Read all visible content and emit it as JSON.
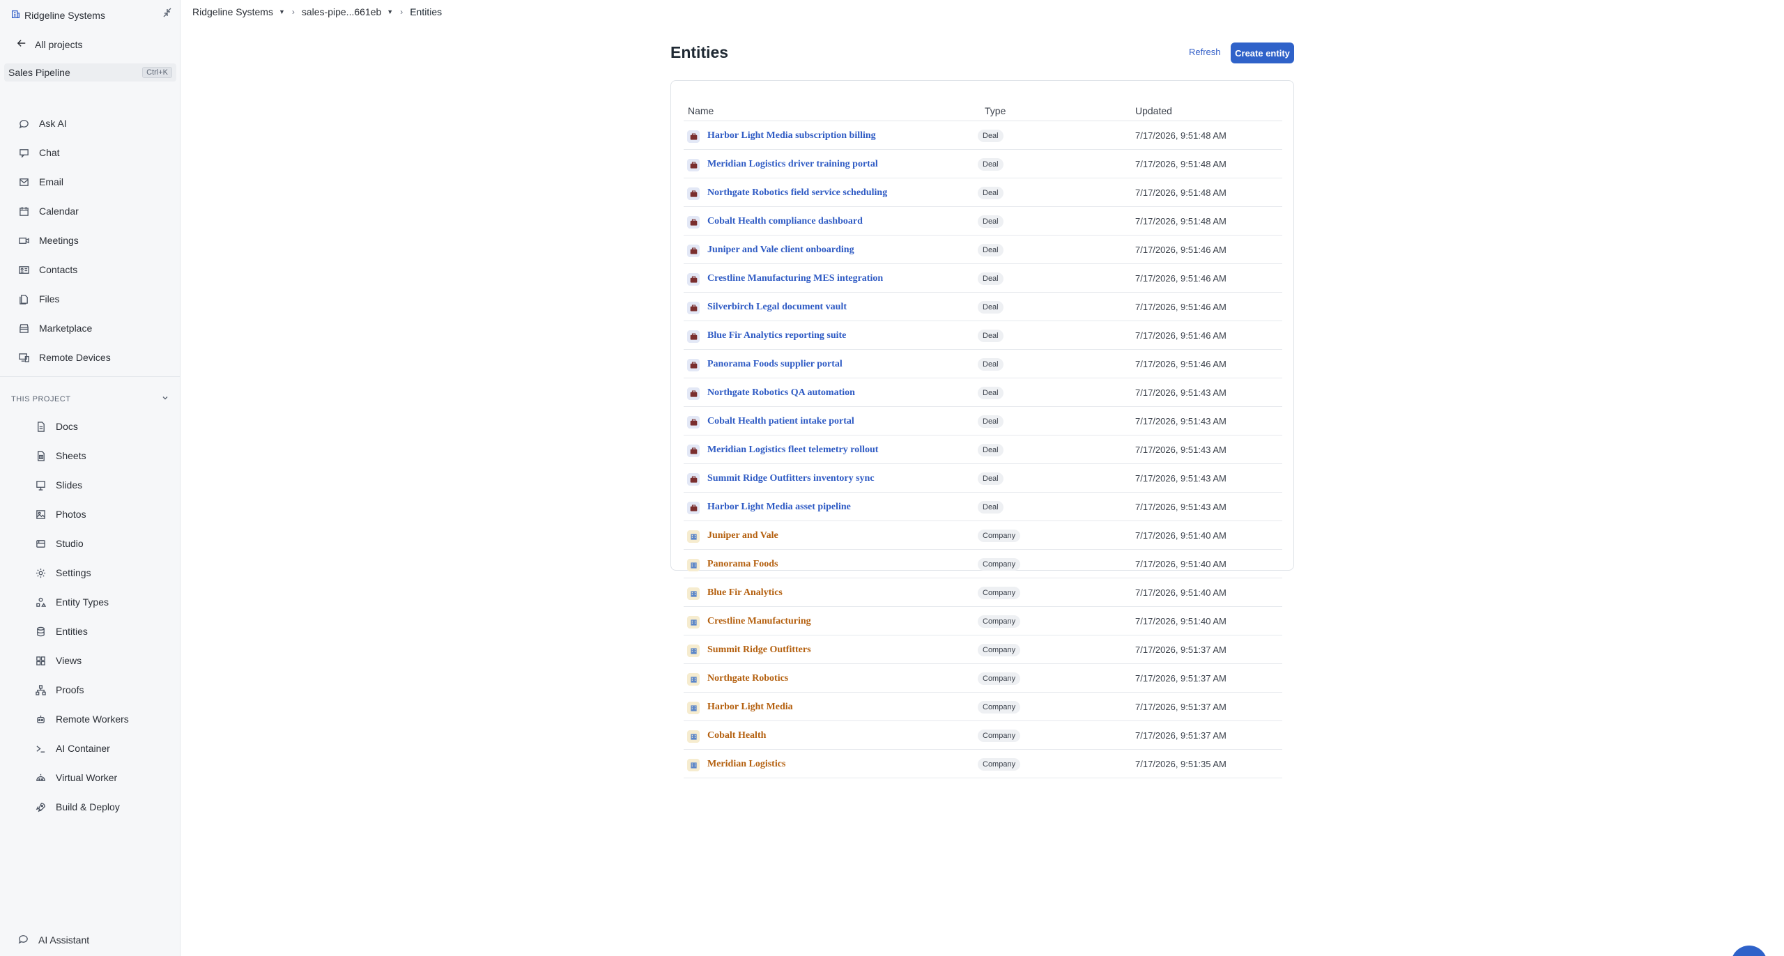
{
  "sidebar": {
    "workspace": "Ridgeline Systems",
    "back_label": "All projects",
    "project": "Sales Pipeline",
    "shortcut": "Ctrl+K",
    "nav": [
      {
        "label": "Ask AI",
        "icon": "chat-bubble-icon"
      },
      {
        "label": "Chat",
        "icon": "chat-icon"
      },
      {
        "label": "Email",
        "icon": "mail-icon"
      },
      {
        "label": "Calendar",
        "icon": "calendar-icon"
      },
      {
        "label": "Meetings",
        "icon": "video-icon"
      },
      {
        "label": "Contacts",
        "icon": "contact-card-icon"
      },
      {
        "label": "Files",
        "icon": "files-icon"
      },
      {
        "label": "Marketplace",
        "icon": "store-icon"
      },
      {
        "label": "Remote Devices",
        "icon": "monitor-icon"
      }
    ],
    "section_title": "THIS PROJECT",
    "project_nav": [
      {
        "label": "Docs",
        "icon": "doc-icon"
      },
      {
        "label": "Sheets",
        "icon": "sheet-icon"
      },
      {
        "label": "Slides",
        "icon": "slides-icon"
      },
      {
        "label": "Photos",
        "icon": "photo-icon"
      },
      {
        "label": "Studio",
        "icon": "studio-icon"
      },
      {
        "label": "Settings",
        "icon": "gear-icon"
      },
      {
        "label": "Entity Types",
        "icon": "shapes-icon"
      },
      {
        "label": "Entities",
        "icon": "database-icon"
      },
      {
        "label": "Views",
        "icon": "grid-icon"
      },
      {
        "label": "Proofs",
        "icon": "hierarchy-icon"
      },
      {
        "label": "Remote Workers",
        "icon": "robot-icon"
      },
      {
        "label": "AI Container",
        "icon": "terminal-icon"
      },
      {
        "label": "Virtual Worker",
        "icon": "bot-icon"
      },
      {
        "label": "Build & Deploy",
        "icon": "rocket-icon"
      }
    ],
    "assistant_label": "AI Assistant"
  },
  "breadcrumb": {
    "workspace": "Ridgeline Systems",
    "project": "sales-pipe...661eb",
    "current": "Entities"
  },
  "main": {
    "title": "Entities",
    "refresh_label": "Refresh",
    "create_label": "Create entity",
    "columns": {
      "name": "Name",
      "type": "Type",
      "updated": "Updated"
    },
    "rows": [
      {
        "name": "Harbor Light Media subscription billing",
        "type": "Deal",
        "updated": "7/17/2026, 9:51:48 AM"
      },
      {
        "name": "Meridian Logistics driver training portal",
        "type": "Deal",
        "updated": "7/17/2026, 9:51:48 AM"
      },
      {
        "name": "Northgate Robotics field service scheduling",
        "type": "Deal",
        "updated": "7/17/2026, 9:51:48 AM"
      },
      {
        "name": "Cobalt Health compliance dashboard",
        "type": "Deal",
        "updated": "7/17/2026, 9:51:48 AM"
      },
      {
        "name": "Juniper and Vale client onboarding",
        "type": "Deal",
        "updated": "7/17/2026, 9:51:46 AM"
      },
      {
        "name": "Crestline Manufacturing MES integration",
        "type": "Deal",
        "updated": "7/17/2026, 9:51:46 AM"
      },
      {
        "name": "Silverbirch Legal document vault",
        "type": "Deal",
        "updated": "7/17/2026, 9:51:46 AM"
      },
      {
        "name": "Blue Fir Analytics reporting suite",
        "type": "Deal",
        "updated": "7/17/2026, 9:51:46 AM"
      },
      {
        "name": "Panorama Foods supplier portal",
        "type": "Deal",
        "updated": "7/17/2026, 9:51:46 AM"
      },
      {
        "name": "Northgate Robotics QA automation",
        "type": "Deal",
        "updated": "7/17/2026, 9:51:43 AM"
      },
      {
        "name": "Cobalt Health patient intake portal",
        "type": "Deal",
        "updated": "7/17/2026, 9:51:43 AM"
      },
      {
        "name": "Meridian Logistics fleet telemetry rollout",
        "type": "Deal",
        "updated": "7/17/2026, 9:51:43 AM"
      },
      {
        "name": "Summit Ridge Outfitters inventory sync",
        "type": "Deal",
        "updated": "7/17/2026, 9:51:43 AM"
      },
      {
        "name": "Harbor Light Media asset pipeline",
        "type": "Deal",
        "updated": "7/17/2026, 9:51:43 AM"
      },
      {
        "name": "Juniper and Vale",
        "type": "Company",
        "updated": "7/17/2026, 9:51:40 AM"
      },
      {
        "name": "Panorama Foods",
        "type": "Company",
        "updated": "7/17/2026, 9:51:40 AM"
      },
      {
        "name": "Blue Fir Analytics",
        "type": "Company",
        "updated": "7/17/2026, 9:51:40 AM"
      },
      {
        "name": "Crestline Manufacturing",
        "type": "Company",
        "updated": "7/17/2026, 9:51:40 AM"
      },
      {
        "name": "Summit Ridge Outfitters",
        "type": "Company",
        "updated": "7/17/2026, 9:51:37 AM"
      },
      {
        "name": "Northgate Robotics",
        "type": "Company",
        "updated": "7/17/2026, 9:51:37 AM"
      },
      {
        "name": "Harbor Light Media",
        "type": "Company",
        "updated": "7/17/2026, 9:51:37 AM"
      },
      {
        "name": "Cobalt Health",
        "type": "Company",
        "updated": "7/17/2026, 9:51:37 AM"
      },
      {
        "name": "Meridian Logistics",
        "type": "Company",
        "updated": "7/17/2026, 9:51:35 AM"
      }
    ]
  },
  "colors": {
    "accent": "#2f62c9",
    "deal_link": "#2f5bc4",
    "company_link": "#b4600f"
  }
}
